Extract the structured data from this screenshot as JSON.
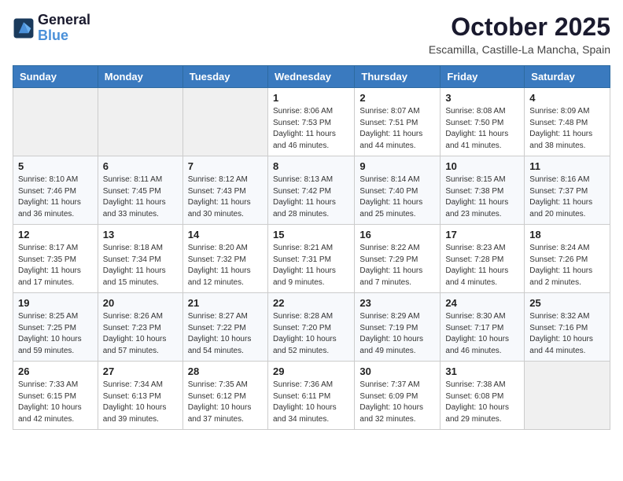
{
  "header": {
    "logo_line1": "General",
    "logo_line2": "Blue",
    "month": "October 2025",
    "location": "Escamilla, Castille-La Mancha, Spain"
  },
  "weekdays": [
    "Sunday",
    "Monday",
    "Tuesday",
    "Wednesday",
    "Thursday",
    "Friday",
    "Saturday"
  ],
  "weeks": [
    [
      {
        "day": "",
        "info": ""
      },
      {
        "day": "",
        "info": ""
      },
      {
        "day": "",
        "info": ""
      },
      {
        "day": "1",
        "info": "Sunrise: 8:06 AM\nSunset: 7:53 PM\nDaylight: 11 hours and 46 minutes."
      },
      {
        "day": "2",
        "info": "Sunrise: 8:07 AM\nSunset: 7:51 PM\nDaylight: 11 hours and 44 minutes."
      },
      {
        "day": "3",
        "info": "Sunrise: 8:08 AM\nSunset: 7:50 PM\nDaylight: 11 hours and 41 minutes."
      },
      {
        "day": "4",
        "info": "Sunrise: 8:09 AM\nSunset: 7:48 PM\nDaylight: 11 hours and 38 minutes."
      }
    ],
    [
      {
        "day": "5",
        "info": "Sunrise: 8:10 AM\nSunset: 7:46 PM\nDaylight: 11 hours and 36 minutes."
      },
      {
        "day": "6",
        "info": "Sunrise: 8:11 AM\nSunset: 7:45 PM\nDaylight: 11 hours and 33 minutes."
      },
      {
        "day": "7",
        "info": "Sunrise: 8:12 AM\nSunset: 7:43 PM\nDaylight: 11 hours and 30 minutes."
      },
      {
        "day": "8",
        "info": "Sunrise: 8:13 AM\nSunset: 7:42 PM\nDaylight: 11 hours and 28 minutes."
      },
      {
        "day": "9",
        "info": "Sunrise: 8:14 AM\nSunset: 7:40 PM\nDaylight: 11 hours and 25 minutes."
      },
      {
        "day": "10",
        "info": "Sunrise: 8:15 AM\nSunset: 7:38 PM\nDaylight: 11 hours and 23 minutes."
      },
      {
        "day": "11",
        "info": "Sunrise: 8:16 AM\nSunset: 7:37 PM\nDaylight: 11 hours and 20 minutes."
      }
    ],
    [
      {
        "day": "12",
        "info": "Sunrise: 8:17 AM\nSunset: 7:35 PM\nDaylight: 11 hours and 17 minutes."
      },
      {
        "day": "13",
        "info": "Sunrise: 8:18 AM\nSunset: 7:34 PM\nDaylight: 11 hours and 15 minutes."
      },
      {
        "day": "14",
        "info": "Sunrise: 8:20 AM\nSunset: 7:32 PM\nDaylight: 11 hours and 12 minutes."
      },
      {
        "day": "15",
        "info": "Sunrise: 8:21 AM\nSunset: 7:31 PM\nDaylight: 11 hours and 9 minutes."
      },
      {
        "day": "16",
        "info": "Sunrise: 8:22 AM\nSunset: 7:29 PM\nDaylight: 11 hours and 7 minutes."
      },
      {
        "day": "17",
        "info": "Sunrise: 8:23 AM\nSunset: 7:28 PM\nDaylight: 11 hours and 4 minutes."
      },
      {
        "day": "18",
        "info": "Sunrise: 8:24 AM\nSunset: 7:26 PM\nDaylight: 11 hours and 2 minutes."
      }
    ],
    [
      {
        "day": "19",
        "info": "Sunrise: 8:25 AM\nSunset: 7:25 PM\nDaylight: 10 hours and 59 minutes."
      },
      {
        "day": "20",
        "info": "Sunrise: 8:26 AM\nSunset: 7:23 PM\nDaylight: 10 hours and 57 minutes."
      },
      {
        "day": "21",
        "info": "Sunrise: 8:27 AM\nSunset: 7:22 PM\nDaylight: 10 hours and 54 minutes."
      },
      {
        "day": "22",
        "info": "Sunrise: 8:28 AM\nSunset: 7:20 PM\nDaylight: 10 hours and 52 minutes."
      },
      {
        "day": "23",
        "info": "Sunrise: 8:29 AM\nSunset: 7:19 PM\nDaylight: 10 hours and 49 minutes."
      },
      {
        "day": "24",
        "info": "Sunrise: 8:30 AM\nSunset: 7:17 PM\nDaylight: 10 hours and 46 minutes."
      },
      {
        "day": "25",
        "info": "Sunrise: 8:32 AM\nSunset: 7:16 PM\nDaylight: 10 hours and 44 minutes."
      }
    ],
    [
      {
        "day": "26",
        "info": "Sunrise: 7:33 AM\nSunset: 6:15 PM\nDaylight: 10 hours and 42 minutes."
      },
      {
        "day": "27",
        "info": "Sunrise: 7:34 AM\nSunset: 6:13 PM\nDaylight: 10 hours and 39 minutes."
      },
      {
        "day": "28",
        "info": "Sunrise: 7:35 AM\nSunset: 6:12 PM\nDaylight: 10 hours and 37 minutes."
      },
      {
        "day": "29",
        "info": "Sunrise: 7:36 AM\nSunset: 6:11 PM\nDaylight: 10 hours and 34 minutes."
      },
      {
        "day": "30",
        "info": "Sunrise: 7:37 AM\nSunset: 6:09 PM\nDaylight: 10 hours and 32 minutes."
      },
      {
        "day": "31",
        "info": "Sunrise: 7:38 AM\nSunset: 6:08 PM\nDaylight: 10 hours and 29 minutes."
      },
      {
        "day": "",
        "info": ""
      }
    ]
  ]
}
